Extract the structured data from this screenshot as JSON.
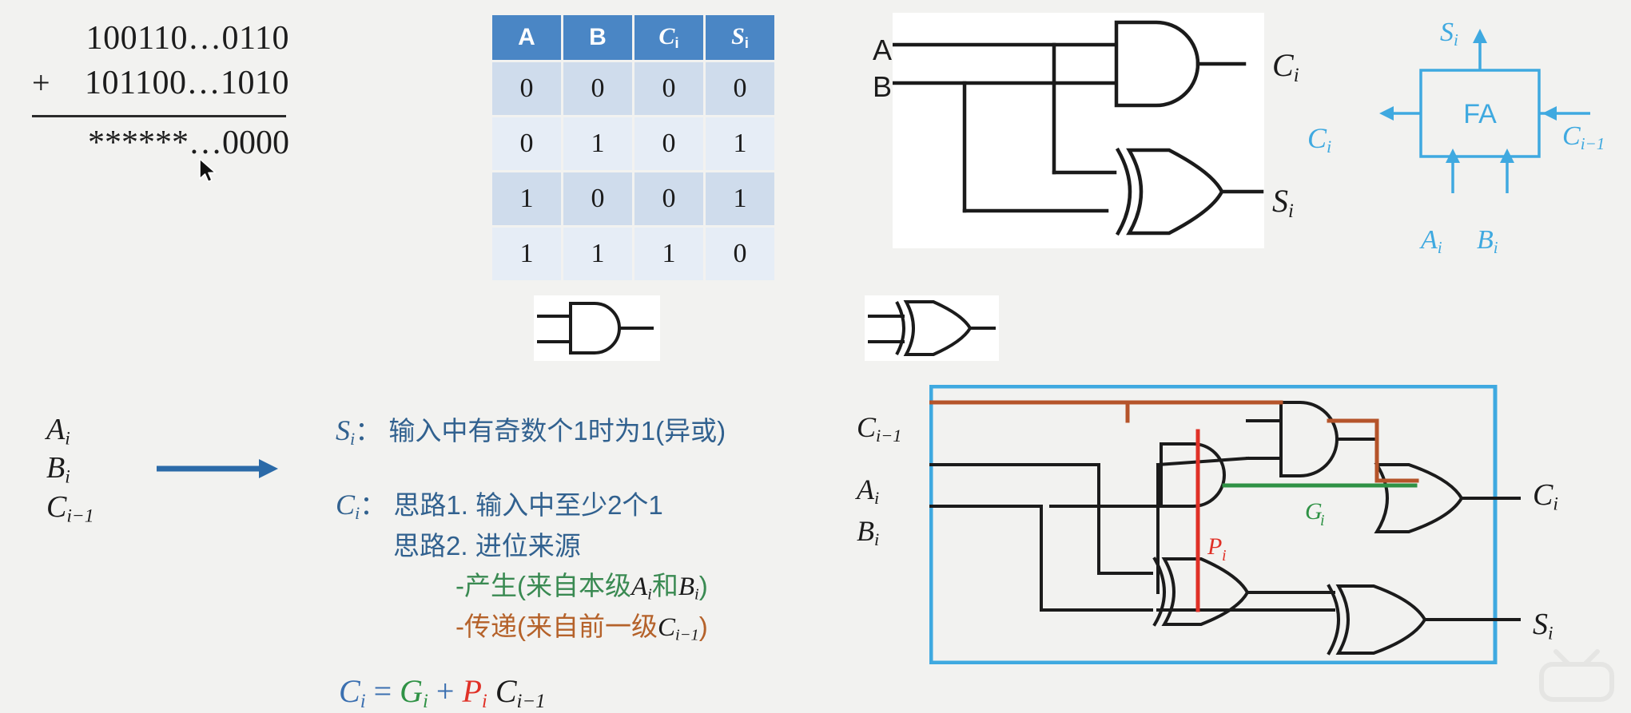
{
  "background_color": "#f2f2f0",
  "accent_blue": "#3fa9e0",
  "table_header_blue": "#4a86c5",
  "addition": {
    "operand1": "100110…0110",
    "plus_sign": "+",
    "operand2": "101100…1010",
    "sum": "******…0000"
  },
  "truth_table": {
    "headers": [
      "A",
      "B",
      "C",
      "S"
    ],
    "header_subscripts": [
      "",
      "",
      "i",
      "i"
    ],
    "rows": [
      [
        "0",
        "0",
        "0",
        "0"
      ],
      [
        "0",
        "1",
        "0",
        "1"
      ],
      [
        "1",
        "0",
        "0",
        "1"
      ],
      [
        "1",
        "1",
        "1",
        "0"
      ]
    ]
  },
  "half_adder": {
    "input_a": "A",
    "input_b": "B",
    "output_carry": "C",
    "output_carry_sub": "i",
    "output_sum": "S",
    "output_sum_sub": "i",
    "and_gate": "and-gate",
    "xor_gate": "xor-gate"
  },
  "fa_block": {
    "box_label": "FA",
    "sum_out": "S",
    "sum_out_sub": "i",
    "carry_out": "C",
    "carry_out_sub": "i",
    "carry_in": "C",
    "carry_in_sub": "i−1",
    "input_a": "A",
    "input_a_sub": "i",
    "input_b": "B",
    "input_b_sub": "i",
    "stray_label_C": "C",
    "stray_label_C_sub": "i",
    "stray_label_S": "S",
    "stray_label_S_sub": "i"
  },
  "gate_legend": {
    "and_label": "and-gate-symbol",
    "xor_label": "xor-gate-symbol"
  },
  "inputs_list": {
    "items": [
      {
        "base": "A",
        "sub": "i"
      },
      {
        "base": "B",
        "sub": "i"
      },
      {
        "base": "C",
        "sub": "i−1"
      }
    ]
  },
  "explanation": {
    "line_s": {
      "label": "S",
      "label_sub": "i",
      "colon": "：",
      "text": "输入中有奇数个1时为1(异或)"
    },
    "line_c": {
      "label": "C",
      "label_sub": "i",
      "colon": "：",
      "idea1": "思路1. 输入中至少2个1",
      "idea2": "思路2. 进位来源",
      "bullet_generate_pre": "-产生(来自本级",
      "bullet_generate_a": "A",
      "bullet_generate_a_sub": "i",
      "bullet_generate_mid": "和",
      "bullet_generate_b": "B",
      "bullet_generate_b_sub": "i",
      "bullet_generate_post": ")",
      "bullet_propagate_pre": "-传递(来自前一级",
      "bullet_propagate_c": "C",
      "bullet_propagate_c_sub": "i−1",
      "bullet_propagate_post": ")"
    }
  },
  "formula": {
    "c": "C",
    "c_sub": "i",
    "eq": "=",
    "g": "G",
    "g_sub": "i",
    "plus": "+",
    "p": "P",
    "p_sub": "i",
    "cprev": "C",
    "cprev_sub": "i−1",
    "color_c": "#3a6fb0",
    "color_g": "#2f9245",
    "color_p": "#e03127",
    "color_cprev": "#1b1b1b"
  },
  "fa_circuit": {
    "in_cim1": "C",
    "in_cim1_sub": "i−1",
    "in_ai": "A",
    "in_ai_sub": "i",
    "in_bi": "B",
    "in_bi_sub": "i",
    "out_ci": "C",
    "out_ci_sub": "i",
    "out_si": "S",
    "out_si_sub": "i",
    "wire_g_label": "G",
    "wire_g_label_sub": "i",
    "wire_p_label": "P",
    "wire_p_label_sub": "i",
    "color_generate": "#2f9245",
    "color_propagate": "#b5542a",
    "color_p_wire": "#e03127",
    "border_color": "#3fa9e0"
  },
  "watermark": {
    "name": "tv-logo-watermark"
  }
}
